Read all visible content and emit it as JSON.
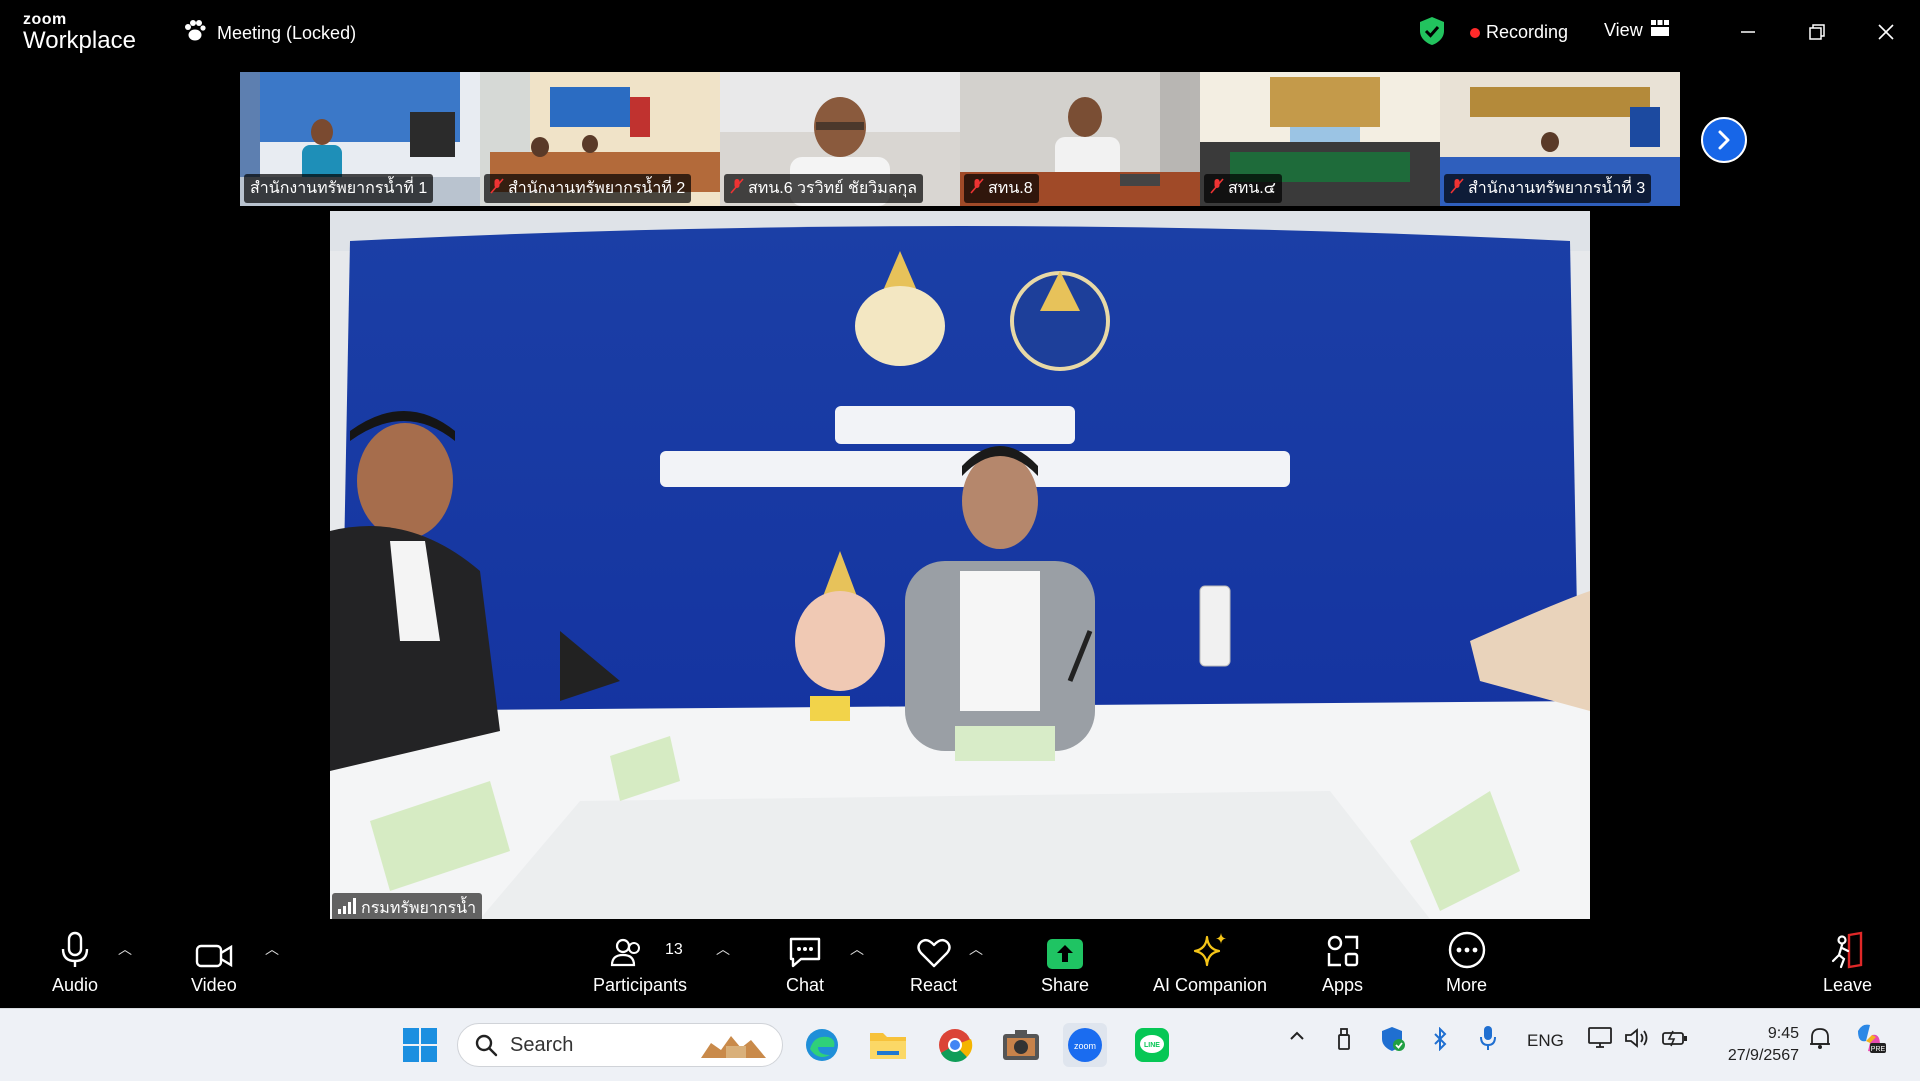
{
  "app": {
    "brand_top": "zoom",
    "brand_bottom": "Workplace"
  },
  "meeting": {
    "title": "Meeting (Locked)"
  },
  "status": {
    "recording_label": "Recording",
    "view_label": "View"
  },
  "colors": {
    "recording_dot": "#ff2a2a",
    "shield": "#22c35e",
    "next_button": "#1766e8",
    "share_green": "#1fc463",
    "ai_star": "#f5c518",
    "leave_red": "#e02828"
  },
  "thumbnails": [
    {
      "name": "สำนักงานทรัพยากรน้ำที่ 1",
      "muted": false
    },
    {
      "name": "สำนักงานทรัพยากรน้ำที่ 2",
      "muted": true
    },
    {
      "name": "สทน.6 วรวิทย์ ชัยวิมลกุล",
      "muted": true
    },
    {
      "name": "สทน.8",
      "muted": true
    },
    {
      "name": "สทน.๔",
      "muted": true
    },
    {
      "name": "สำนักงานทรัพยากรน้ำที่ 3",
      "muted": true
    }
  ],
  "main_video": {
    "speaker_name": "กรมทรัพยากรน้ำ"
  },
  "toolbar": {
    "audio": "Audio",
    "video": "Video",
    "participants": "Participants",
    "participants_count": "13",
    "chat": "Chat",
    "react": "React",
    "share": "Share",
    "ai_companion": "AI Companion",
    "apps": "Apps",
    "more": "More",
    "leave": "Leave"
  },
  "taskbar": {
    "search_placeholder": "Search",
    "language": "ENG",
    "time": "9:45",
    "date": "27/9/2567"
  }
}
